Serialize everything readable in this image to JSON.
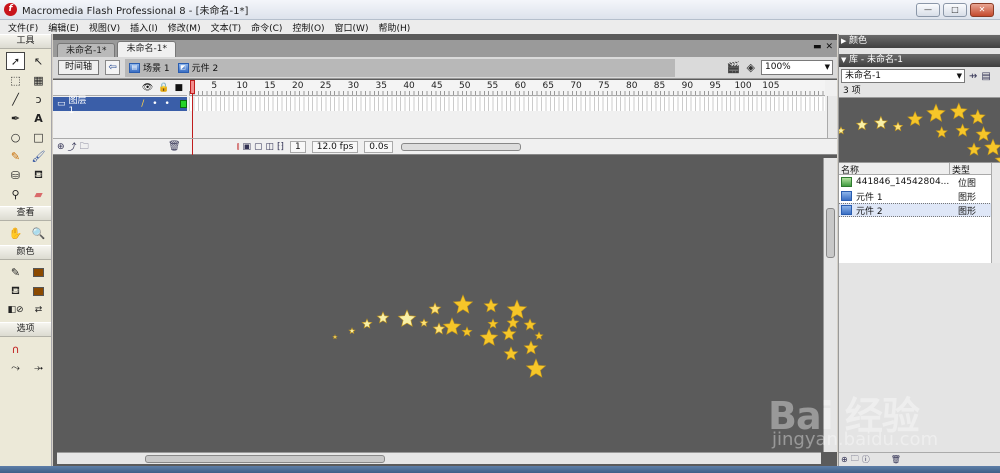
{
  "window": {
    "title": "Macromedia Flash Professional 8 - [未命名-1*]",
    "minimize": "—",
    "restore": "□",
    "close": "✕"
  },
  "menu": [
    "文件(F)",
    "编辑(E)",
    "视图(V)",
    "插入(I)",
    "修改(M)",
    "文本(T)",
    "命令(C)",
    "控制(O)",
    "窗口(W)",
    "帮助(H)"
  ],
  "tools": {
    "title": "工具",
    "view_title": "查看",
    "color_title": "颜色",
    "options_title": "选项",
    "stroke_color": "#8b4a00",
    "fill_color": "#8b4a00"
  },
  "document": {
    "tabs": [
      "未命名-1*",
      "未命名-1*"
    ],
    "timeline_button": "时间轴",
    "scene": "场景 1",
    "symbol": "元件 2",
    "zoom": "100%",
    "controls": [
      "▬",
      "✕"
    ]
  },
  "timeline": {
    "layer_name": "图层 1",
    "ruler": [
      "1",
      "5",
      "10",
      "15",
      "20",
      "25",
      "30",
      "35",
      "40",
      "45",
      "50",
      "55",
      "60",
      "65",
      "70",
      "75",
      "80",
      "85",
      "90",
      "95",
      "100",
      "105"
    ],
    "current_frame": "1",
    "fps": "12.0 fps",
    "time": "0.0s"
  },
  "color_panel": {
    "title": "颜色"
  },
  "library": {
    "title": "库 - 未命名-1",
    "document": "未命名-1",
    "count": "3 项",
    "col_name": "名称",
    "col_type": "类型",
    "items": [
      {
        "name": "441846_14542804...",
        "type": "位图",
        "icon": "bitmap-icon"
      },
      {
        "name": "元件 1",
        "type": "图形",
        "icon": "graphic-symbol-icon"
      },
      {
        "name": "元件 2",
        "type": "图形",
        "icon": "graphic-symbol-icon"
      }
    ]
  },
  "watermark": {
    "brand": "Bai 经验",
    "sub": "jingyan.baidu.com"
  }
}
